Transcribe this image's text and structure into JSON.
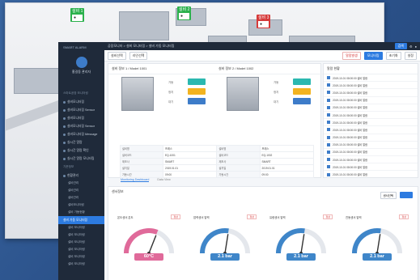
{
  "back_card": {
    "tags": [
      {
        "title": "설비 1",
        "body": "●"
      },
      {
        "title": "설비 2",
        "body": "●"
      },
      {
        "title": "설비 3",
        "body": "●"
      }
    ]
  },
  "sidebar": {
    "logo": "SMART ALARM",
    "profile_name": "홍길동 관리자",
    "section_head": "스마트공장 모니터링",
    "items": [
      "설비모니터링",
      "설비모니터링 Sensor",
      "설비모니터링",
      "설비모니터링 Sensor",
      "설비모니터링 Message",
      "실시간 알람",
      "실시간 알람 확인",
      "실시간 알람 모니터링"
    ],
    "section_head2": "기준정보",
    "section_head3": "현황관리",
    "subitems": [
      "설비관리",
      "설비관리",
      "설비관리",
      "설비모니터링",
      "설비 가동현황"
    ],
    "active_item": "설비 가동 모니터링",
    "more_items": [
      "설비 모니터링",
      "설비 모니터링",
      "설비 모니터링",
      "설비 모니터링",
      "설비 모니터링",
      "설비 모니터링"
    ]
  },
  "topbar": {
    "breadcrumb": "공장모니터 > 설비 모니터링 > 설비 가동 모니터링",
    "search_placeholder": "검색",
    "button": "검색"
  },
  "subbar": {
    "select1": "설비선택",
    "select2": "라인선택",
    "alert_text": "알람발생",
    "btn_blue": "모니터링",
    "btn_gray": "초기화",
    "btn_gray2": "설정"
  },
  "equip_panel": {
    "title1": "설비 정보 1 / Model 1001",
    "title2": "설비 정보 2 / Model 1002",
    "stat_labels": [
      "가동",
      "정지",
      "대기"
    ]
  },
  "info_table": {
    "rows": [
      [
        "설비명",
        "프레스",
        "설비명",
        "프레스"
      ],
      [
        "설비코드",
        "EQ-1001",
        "설비코드",
        "EQ-1002"
      ],
      [
        "제조사",
        "SMART",
        "제조사",
        "SMART"
      ],
      [
        "설치일",
        "2019.01.01",
        "설치일",
        "2019.01.01"
      ],
      [
        "가동시간",
        "09:00",
        "가동시간",
        "09:00"
      ]
    ]
  },
  "alarm_panel": {
    "title": "알람 현황",
    "rows": [
      "2019-10-01 08:00:00 설비 알람",
      "2019-10-01 08:00:00 설비 알람",
      "2019-10-01 08:00:00 설비 알람",
      "2019-10-01 08:00:00 설비 알람",
      "2019-10-01 08:00:00 설비 알람",
      "2019-10-01 08:00:00 설비 알람",
      "2019-10-01 08:00:00 설비 알람",
      "2019-10-01 08:00:00 설비 알람",
      "2019-10-01 08:00:00 설비 알람",
      "2019-10-01 08:00:00 설비 알람",
      "2019-10-01 08:00:00 설비 알람",
      "2019-10-01 08:00:00 설비 알람",
      "2019-10-01 08:00:00 설비 알람",
      "2019-10-01 08:00:00 설비 알람",
      "2019-10-01 08:00:00 설비 알람"
    ]
  },
  "tabs": [
    "Monitoring Dashboard",
    "Data View"
  ],
  "sensor_section": {
    "title": "센서정보",
    "select": "센서선택"
  },
  "gauges": [
    {
      "title": "온도센서 온도",
      "badge": "정상",
      "value": "60°C",
      "level": 0.62,
      "color": "#e06a9a",
      "style": "pink"
    },
    {
      "title": "압력센서 압력",
      "badge": "정상",
      "value": "2.1 bar",
      "level": 0.55,
      "color": "#3f86c9",
      "style": "blue"
    },
    {
      "title": "유량센서 압력",
      "badge": "정상",
      "value": "2.1 bar",
      "level": 0.55,
      "color": "#3f86c9",
      "style": "blue"
    },
    {
      "title": "진동센서 압력",
      "badge": "정상",
      "value": "2.1 bar",
      "level": 0.55,
      "color": "#3f86c9",
      "style": "blue"
    }
  ]
}
